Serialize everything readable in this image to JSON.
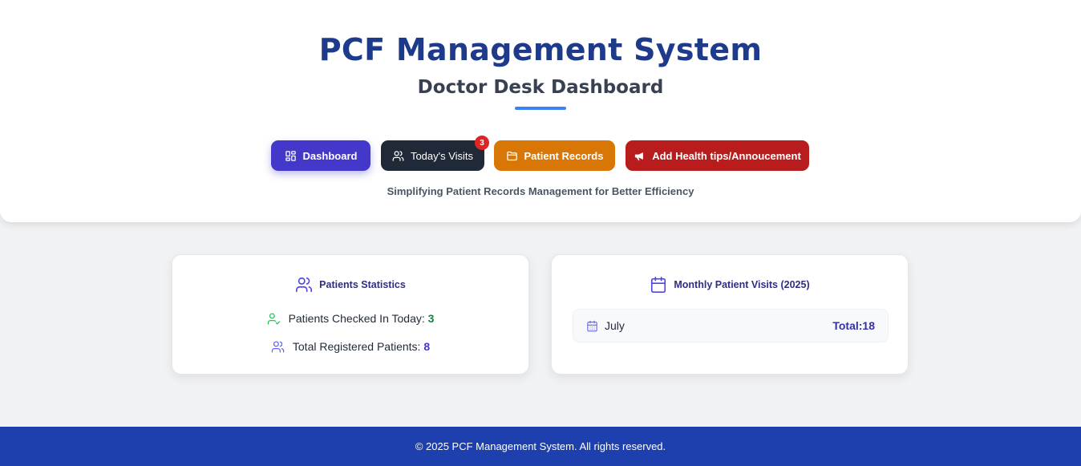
{
  "header": {
    "title": "PCF Management System",
    "subtitle": "Doctor Desk Dashboard",
    "tagline": "Simplifying Patient Records Management for Better Efficiency"
  },
  "nav": {
    "dashboard": {
      "label": "Dashboard",
      "icon": "grid-icon",
      "color": "#4338ca"
    },
    "todays_visits": {
      "label": "Today's Visits",
      "icon": "users-icon",
      "color": "#1f2937",
      "badge": "3"
    },
    "patient_records": {
      "label": "Patient Records",
      "icon": "folder-icon",
      "color": "#d97706"
    },
    "health_tips": {
      "label": "Add Health tips/Annoucement",
      "icon": "megaphone-icon",
      "color": "#b91c1c"
    }
  },
  "stats_card": {
    "title": "Patients Statistics",
    "checked_in_label": "Patients Checked In Today:",
    "checked_in_value": "3",
    "total_label": "Total Registered Patients:",
    "total_value": "8"
  },
  "visits_card": {
    "title": "Monthly Patient Visits (2025)",
    "months": [
      {
        "month": "July",
        "total": "Total:18"
      }
    ]
  },
  "footer": {
    "text": "© 2025 PCF Management System. All rights reserved."
  },
  "colors": {
    "brand": "#1e3a8a",
    "accent": "#3b82f6",
    "footer": "#1e40af",
    "success": "#15803d",
    "badge": "#dc2626"
  }
}
